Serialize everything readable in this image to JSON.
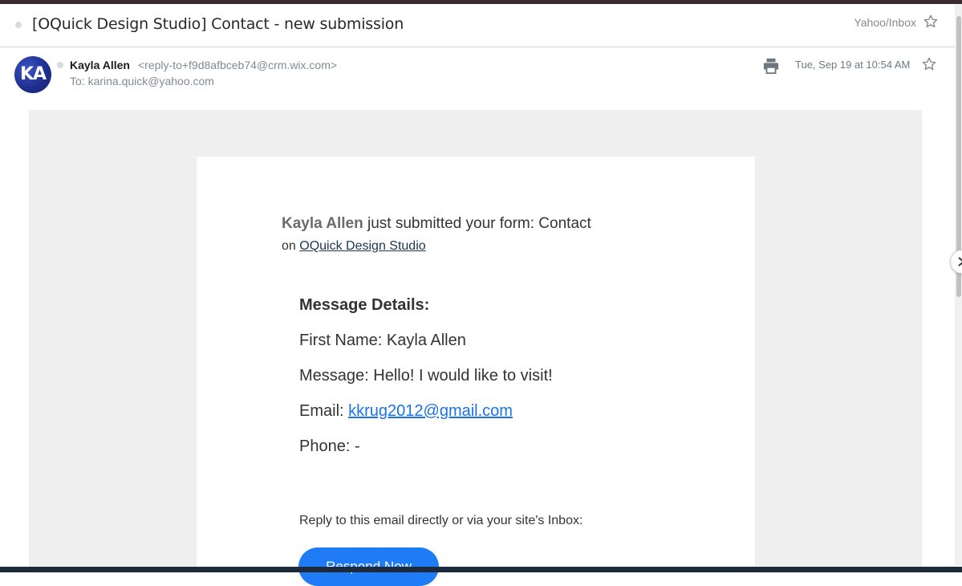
{
  "email": {
    "subject": "[OQuick Design Studio] Contact - new submission",
    "folder": "Yahoo/Inbox",
    "sender": {
      "initials": "KA",
      "name": "Kayla Allen",
      "address": "<reply-to+f9d8afbceb74@crm.wix.com>"
    },
    "to": "To: karina.quick@yahoo.com",
    "date": "Tue, Sep 19 at 10:54 AM"
  },
  "body": {
    "submitter": "Kayla Allen",
    "headline_rest": " just submitted your form: Contact",
    "site_prefix": "on ",
    "site_name": "OQuick Design Studio",
    "details_heading": "Message Details:",
    "first_name_label": "First Name: ",
    "first_name_value": "Kayla Allen",
    "message_label": "Message: ",
    "message_value": "Hello! I would like to visit!",
    "email_label": "Email: ",
    "email_value": "kkrug2012@gmail.com",
    "phone_label": "Phone: ",
    "phone_value": "-",
    "reply_note": "Reply to this email directly or via your site's Inbox:",
    "respond_button": "Respond Now"
  },
  "colors": {
    "accent_button": "#1f7cf6",
    "link": "#1a73e8",
    "avatar": "#1f2f8f"
  },
  "icons": [
    "subject-star-icon",
    "print-icon",
    "message-star-icon",
    "chevron-right-icon"
  ]
}
